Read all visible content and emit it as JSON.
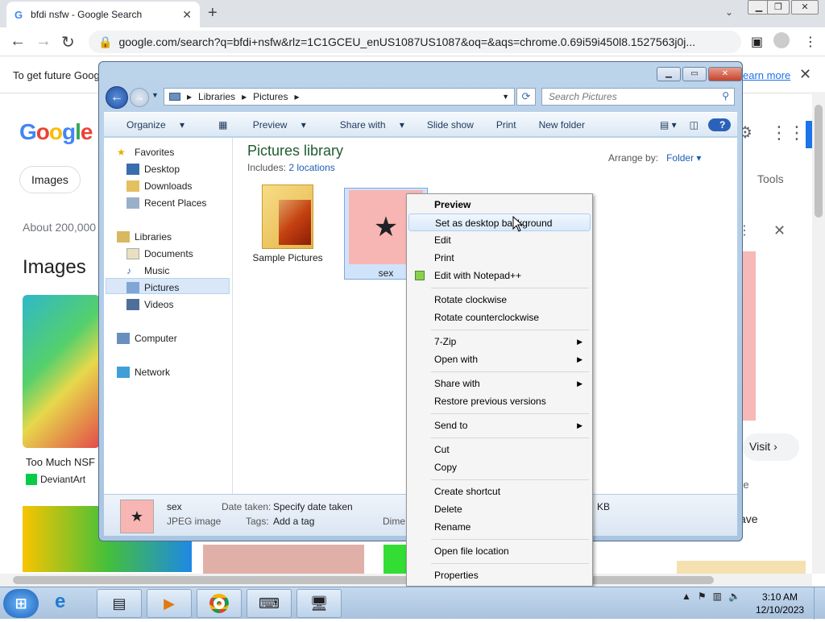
{
  "browser": {
    "tab_title": "bfdi nsfw - Google Search",
    "new_tab": "+",
    "tab_close": "✕",
    "url": "google.com/search?q=bfdi+nsfw&rlz=1C1GCEU_enUS1087US1087&oq=&aqs=chrome.0.69i59i450l8.1527563j0j...",
    "infobar_text": "To get future Goog",
    "infobar_link": "earn more",
    "window_controls": [
      "▁",
      "❐",
      "✕"
    ]
  },
  "google": {
    "logo": "Google",
    "pill_images": "Images",
    "tools": "Tools",
    "about": "About 200,000",
    "images_heading": "Images",
    "result_title": "Too Much NSF",
    "result_source": "DeviantArt",
    "visit": "Visit",
    "re": "re",
    "ave": "ave",
    "kb": "KB"
  },
  "explorer": {
    "breadcrumb": [
      "Libraries",
      "Pictures"
    ],
    "search_placeholder": "Search Pictures",
    "commands": [
      "Organize",
      "Preview",
      "Share with",
      "Slide show",
      "Print",
      "New folder"
    ],
    "nav": {
      "favorites": "Favorites",
      "desktop": "Desktop",
      "downloads": "Downloads",
      "recent": "Recent Places",
      "libraries": "Libraries",
      "documents": "Documents",
      "music": "Music",
      "pictures": "Pictures",
      "videos": "Videos",
      "computer": "Computer",
      "network": "Network"
    },
    "library_title": "Pictures library",
    "includes_label": "Includes:",
    "includes_link": "2 locations",
    "arrange_label": "Arrange by:",
    "arrange_value": "Folder",
    "items": {
      "folder_name": "Sample Pictures",
      "file_name": "sex"
    },
    "details": {
      "name": "sex",
      "type": "JPEG image",
      "date_label": "Date taken:",
      "date_value": "Specify date taken",
      "tags_label": "Tags:",
      "tags_value": "Add a tag",
      "dim_label": "Dime"
    }
  },
  "context_menu": {
    "preview": "Preview",
    "set_desktop": "Set as desktop background",
    "edit": "Edit",
    "print": "Print",
    "edit_notepad": "Edit with Notepad++",
    "rotate_cw": "Rotate clockwise",
    "rotate_ccw": "Rotate counterclockwise",
    "zip": "7-Zip",
    "open_with": "Open with",
    "share_with": "Share with",
    "restore": "Restore previous versions",
    "send_to": "Send to",
    "cut": "Cut",
    "copy": "Copy",
    "create_shortcut": "Create shortcut",
    "delete": "Delete",
    "rename": "Rename",
    "open_location": "Open file location",
    "properties": "Properties"
  },
  "taskbar": {
    "time": "3:10 AM",
    "date": "12/10/2023"
  }
}
